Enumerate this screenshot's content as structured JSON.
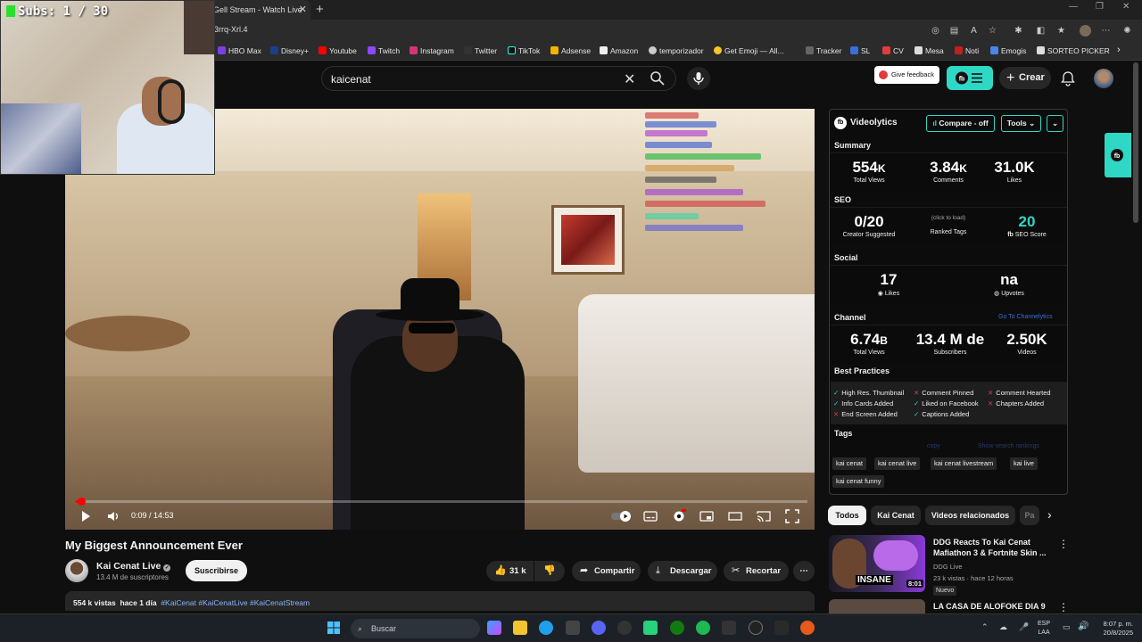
{
  "browser": {
    "tab_title": "Gell Stream - Watch Live",
    "url": "3rrq-Xrl.4",
    "bookmarks": [
      "HBO Max",
      "Disney+",
      "Youtube",
      "Twitch",
      "Instagram",
      "Twitter",
      "TikTok",
      "Adsense",
      "Amazon",
      "temporizador",
      "Get Emoji — All...",
      "Tracker",
      "SL",
      "CV",
      "Mesa",
      "Noti",
      "Emogis",
      "SORTEO PICKER"
    ]
  },
  "overlay": {
    "subs_counter": "Subs: 1 / 30"
  },
  "header": {
    "search_value": "kaicenat",
    "feedback_label": "Give feedback",
    "create_label": "Crear"
  },
  "player": {
    "time": "0:09 / 14:53",
    "progress": 0.01
  },
  "video": {
    "title": "My Biggest Announcement Ever",
    "channel_name": "Kai Cenat Live",
    "channel_subs": "13.4 M de suscriptores",
    "subscribe_label": "Suscribirse",
    "likes": "31 k",
    "share_label": "Compartir",
    "download_label": "Descargar",
    "clip_label": "Recortar",
    "views": "554 k vistas",
    "age": "hace 1 día",
    "hashtags": "#KaiCenat #KaiCenatLive #KaiCenatStream"
  },
  "videolytics": {
    "title": "Videolytics",
    "compare_label": "Compare - off",
    "tools_label": "Tools",
    "summary_title": "Summary",
    "summary": [
      {
        "value": "554",
        "unit": "K",
        "label": "Total Views"
      },
      {
        "value": "3.84",
        "unit": "K",
        "label": "Comments"
      },
      {
        "value": "31.0K",
        "unit": "",
        "label": "Likes"
      }
    ],
    "seo_title": "SEO",
    "seo": [
      {
        "value": "0/20",
        "label": "Creator Suggested"
      },
      {
        "value": "(click to load)",
        "label": "Ranked Tags"
      },
      {
        "value": "20",
        "label": "SEO Score"
      }
    ],
    "social_title": "Social",
    "social": [
      {
        "value": "17",
        "label": "Likes"
      },
      {
        "value": "na",
        "label": "Upvotes"
      }
    ],
    "channel_title": "Channel",
    "channel_link": "Go To Channelytics",
    "channel": [
      {
        "value": "6.74",
        "unit": "B",
        "label": "Total Views"
      },
      {
        "value": "13.4 M de",
        "unit": "",
        "label": "Subscribers"
      },
      {
        "value": "2.50K",
        "unit": "",
        "label": "Videos"
      }
    ],
    "best_practices_title": "Best Practices",
    "best_practices": [
      {
        "label": "High Res. Thumbnail",
        "ok": true
      },
      {
        "label": "Comment Pinned",
        "ok": false
      },
      {
        "label": "Comment Hearted",
        "ok": false
      },
      {
        "label": "Info Cards Added",
        "ok": true
      },
      {
        "label": "Liked on Facebook",
        "ok": true
      },
      {
        "label": "Chapters Added",
        "ok": false
      },
      {
        "label": "End Screen Added",
        "ok": false
      },
      {
        "label": "Captions Added",
        "ok": true
      }
    ],
    "tags_title": "Tags",
    "tags_copy": "copy",
    "tags_show": "Show search rankings",
    "tags": [
      "kai cenat",
      "kai cenat live",
      "kai cenat livestream",
      "kai live",
      "kai cenat funny"
    ]
  },
  "chips": [
    "Todos",
    "Kai Cenat",
    "Videos relacionados",
    "Pa"
  ],
  "recommendations": [
    {
      "title": "DDG Reacts To Kai Cenat Mafiathon 3 & Fortnite Skin ...",
      "channel": "DDG Live",
      "meta": "23 k vistas · hace 12 horas",
      "badge": "Nuevo",
      "duration": "8:01"
    },
    {
      "title": "LA CASA DE ALOFOKE DIA 9"
    }
  ],
  "taskbar": {
    "search_label": "Buscar",
    "lang_1": "ESP",
    "lang_2": "LAA",
    "time": "8:07 p. m.",
    "date": "20/8/2025"
  },
  "colors": {
    "accent": "#2fd8c5",
    "youtube_red": "#ff0000",
    "background": "#0f0f0f"
  }
}
